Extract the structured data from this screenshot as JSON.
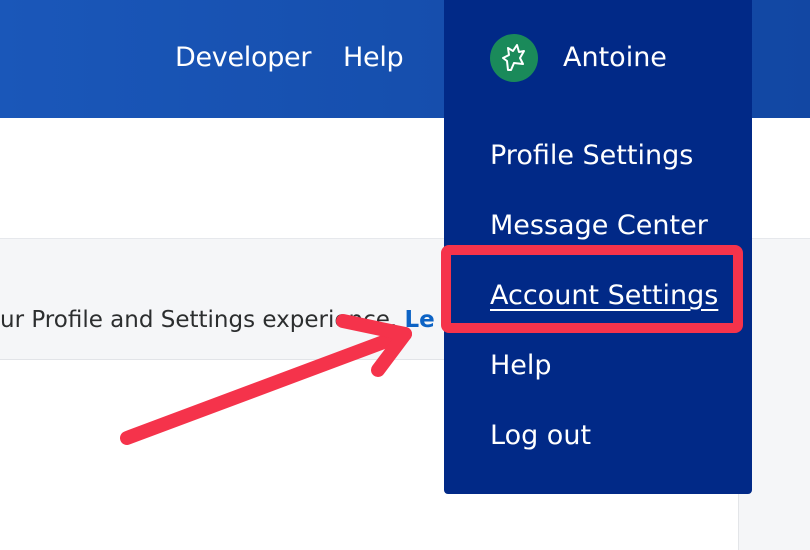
{
  "topnav": {
    "developer": "Developer",
    "help": "Help"
  },
  "account": {
    "name": "Antoine",
    "avatar_icon": "leaf-avatar-icon"
  },
  "menu": {
    "items": [
      {
        "label": "Profile Settings"
      },
      {
        "label": "Message Center"
      },
      {
        "label": "Account Settings",
        "active": true
      },
      {
        "label": "Help"
      },
      {
        "label": "Log out"
      }
    ]
  },
  "notice": {
    "text": "ur Profile and Settings experience. ",
    "link": "Le"
  },
  "annotation": {
    "highlight_color": "#f5334b",
    "arrow_color": "#f5334b"
  },
  "colors": {
    "header": "#1a57b9",
    "dropdown": "#012987",
    "link": "#0d63c5"
  }
}
